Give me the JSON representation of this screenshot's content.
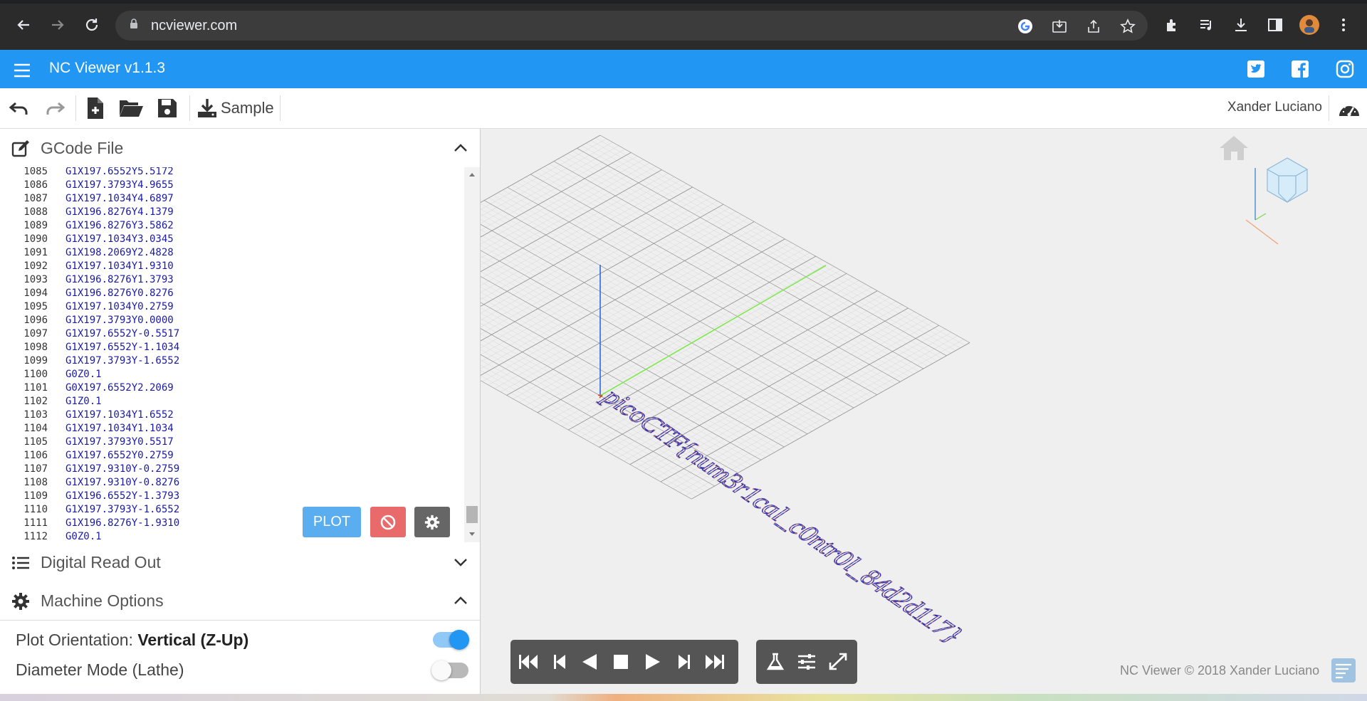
{
  "browser": {
    "url": "ncviewer.com"
  },
  "app": {
    "title": "NC Viewer  v1.1.3"
  },
  "toolbar": {
    "sample_label": "Sample",
    "user_name": "Xander Luciano"
  },
  "gcode_panel": {
    "title": "GCode File",
    "lines": [
      {
        "n": "1085",
        "code": "G1X197.6552Y5.5172"
      },
      {
        "n": "1086",
        "code": "G1X197.3793Y4.9655"
      },
      {
        "n": "1087",
        "code": "G1X197.1034Y4.6897"
      },
      {
        "n": "1088",
        "code": "G1X196.8276Y4.1379"
      },
      {
        "n": "1089",
        "code": "G1X196.8276Y3.5862"
      },
      {
        "n": "1090",
        "code": "G1X197.1034Y3.0345"
      },
      {
        "n": "1091",
        "code": "G1X198.2069Y2.4828"
      },
      {
        "n": "1092",
        "code": "G1X197.1034Y1.9310"
      },
      {
        "n": "1093",
        "code": "G1X196.8276Y1.3793"
      },
      {
        "n": "1094",
        "code": "G1X196.8276Y0.8276"
      },
      {
        "n": "1095",
        "code": "G1X197.1034Y0.2759"
      },
      {
        "n": "1096",
        "code": "G1X197.3793Y0.0000"
      },
      {
        "n": "1097",
        "code": "G1X197.6552Y-0.5517"
      },
      {
        "n": "1098",
        "code": "G1X197.6552Y-1.1034"
      },
      {
        "n": "1099",
        "code": "G1X197.3793Y-1.6552"
      },
      {
        "n": "1100",
        "code": "G0Z0.1"
      },
      {
        "n": "1101",
        "code": "G0X197.6552Y2.2069"
      },
      {
        "n": "1102",
        "code": "G1Z0.1"
      },
      {
        "n": "1103",
        "code": "G1X197.1034Y1.6552"
      },
      {
        "n": "1104",
        "code": "G1X197.1034Y1.1034"
      },
      {
        "n": "1105",
        "code": "G1X197.3793Y0.5517"
      },
      {
        "n": "1106",
        "code": "G1X197.6552Y0.2759"
      },
      {
        "n": "1107",
        "code": "G1X197.9310Y-0.2759"
      },
      {
        "n": "1108",
        "code": "G1X197.9310Y-0.8276"
      },
      {
        "n": "1109",
        "code": "G1X196.6552Y-1.3793"
      },
      {
        "n": "1110",
        "code": "G1X197.3793Y-1.6552"
      },
      {
        "n": "1111",
        "code": "G1X196.8276Y-1.9310"
      },
      {
        "n": "1112",
        "code": "G0Z0.1"
      }
    ],
    "plot_label": "PLOT"
  },
  "dro_panel": {
    "title": "Digital Read Out"
  },
  "machine_panel": {
    "title": "Machine Options",
    "plot_orientation_label": "Plot Orientation:",
    "plot_orientation_value": "Vertical (Z-Up)",
    "plot_orientation_on": true,
    "diameter_label": "Diameter Mode (Lathe)",
    "diameter_on": false
  },
  "viewer": {
    "toolpath_text": "picoCTF{num3r1cal_c0ntr0l_84d2d117}",
    "copyright": "NC Viewer © 2018 Xander Luciano"
  },
  "colors": {
    "header_blue": "#2196f3",
    "plot_button": "#5aaef0",
    "cancel_button": "#e86a6a",
    "toggle_on": "#2196f3"
  }
}
